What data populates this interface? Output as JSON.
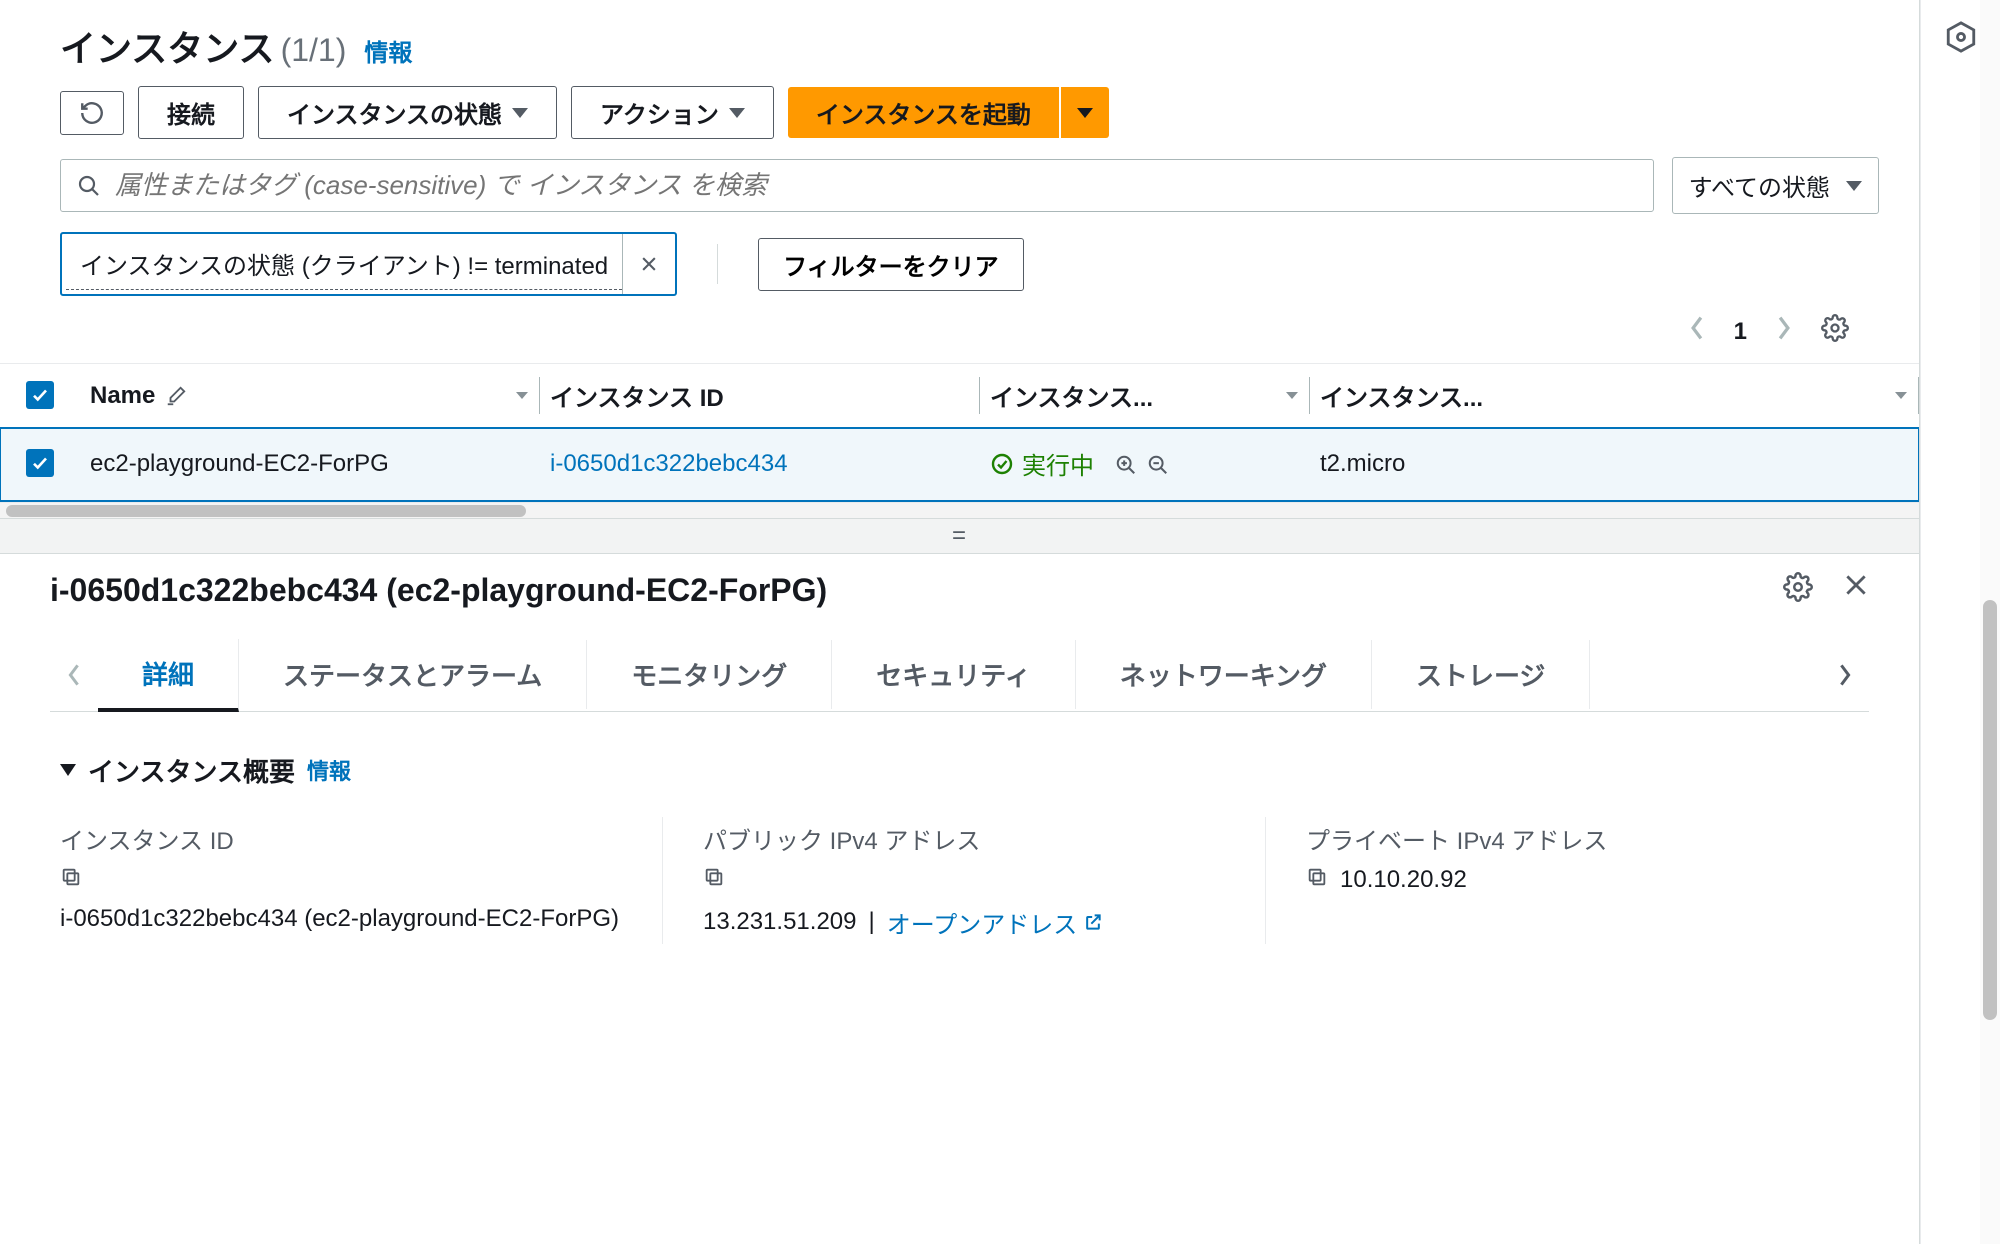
{
  "header": {
    "title": "インスタンス",
    "count": "(1/1)",
    "info": "情報"
  },
  "toolbar": {
    "connect": "接続",
    "instance_state": "インスタンスの状態",
    "actions": "アクション",
    "launch": "インスタンスを起動"
  },
  "search": {
    "placeholder": "属性またはタグ (case-sensitive) で インスタンス を検索",
    "state_filter": "すべての状態"
  },
  "chip": {
    "text": "インスタンスの状態 (クライアント) != terminated",
    "clear": "フィルターをクリア"
  },
  "pager": {
    "page": "1"
  },
  "table": {
    "cols": {
      "name": "Name",
      "instance_id": "インスタンス ID",
      "instance_state": "インスタンス...",
      "instance_type": "インスタンス..."
    },
    "row": {
      "name": "ec2-playground-EC2-ForPG",
      "instance_id": "i-0650d1c322bebc434",
      "state": "実行中",
      "type": "t2.micro"
    }
  },
  "detail": {
    "title": "i-0650d1c322bebc434 (ec2-playground-EC2-ForPG)",
    "tabs": {
      "details": "詳細",
      "status": "ステータスとアラーム",
      "monitoring": "モニタリング",
      "security": "セキュリティ",
      "networking": "ネットワーキング",
      "storage": "ストレージ"
    },
    "overview": {
      "heading": "インスタンス概要",
      "info": "情報",
      "instance_id_label": "インスタンス ID",
      "instance_id_value": "i-0650d1c322bebc434 (ec2-playground-EC2-ForPG)",
      "public_ip_label": "パブリック IPv4 アドレス",
      "public_ip_value": "13.231.51.209",
      "open_address": "オープンアドレス",
      "private_ip_label": "プライベート IPv4 アドレス",
      "private_ip_value": "10.10.20.92"
    }
  }
}
